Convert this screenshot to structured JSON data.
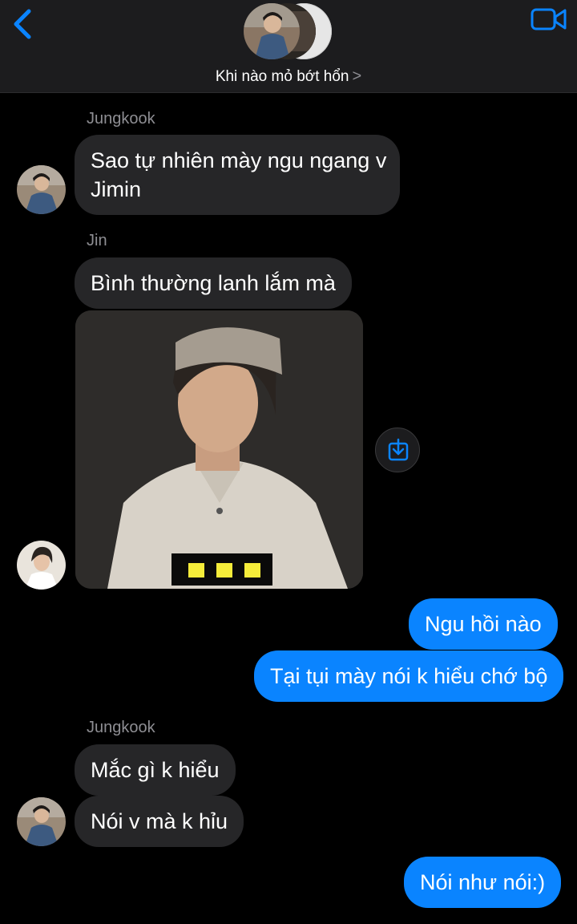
{
  "header": {
    "group_name": "Khi nào mỏ bớt hổn",
    "chevron": ">",
    "back_icon": "chevron-left-icon",
    "video_icon": "video-camera-icon",
    "accent_color": "#0a84ff"
  },
  "messages": [
    {
      "sender": "Jungkook",
      "lines": [
        "Sao tự nhiên mày ngu ngang v",
        "Jimin"
      ]
    },
    {
      "sender": "Jin",
      "text": "Bình thường lanh lắm mà"
    },
    {
      "text": "Ngu hồi nào"
    },
    {
      "text": "Tại tụi mày nói k hiểu chớ bộ"
    },
    {
      "sender": "Jungkook",
      "text": "Mắc gì k hiểu"
    },
    {
      "text": "Nói v mà k hỉu"
    },
    {
      "text": "Nói như nói:)"
    }
  ],
  "photo_attachment": {
    "save_icon": "download-icon"
  }
}
